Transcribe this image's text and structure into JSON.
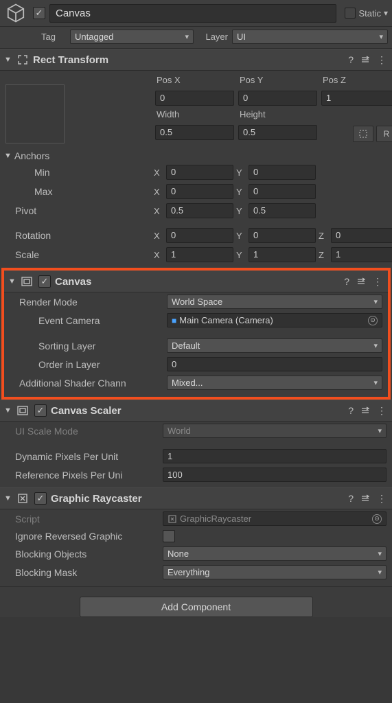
{
  "header": {
    "name": "Canvas",
    "enabled": true,
    "static_checked": false,
    "static_label": "Static",
    "tag_label": "Tag",
    "tag_value": "Untagged",
    "layer_label": "Layer",
    "layer_value": "UI"
  },
  "rect_transform": {
    "title": "Rect Transform",
    "pos_x_label": "Pos X",
    "pos_x": "0",
    "pos_y_label": "Pos Y",
    "pos_y": "0",
    "pos_z_label": "Pos Z",
    "pos_z": "1",
    "width_label": "Width",
    "width": "0.5",
    "height_label": "Height",
    "height": "0.5",
    "anchors_label": "Anchors",
    "min_label": "Min",
    "min_x": "0",
    "min_y": "0",
    "max_label": "Max",
    "max_x": "0",
    "max_y": "0",
    "pivot_label": "Pivot",
    "pivot_x": "0.5",
    "pivot_y": "0.5",
    "rotation_label": "Rotation",
    "rot_x": "0",
    "rot_y": "0",
    "rot_z": "0",
    "scale_label": "Scale",
    "scale_x": "1",
    "scale_y": "1",
    "scale_z": "1",
    "blueprint_btn": "⊡",
    "raw_btn": "R"
  },
  "canvas": {
    "title": "Canvas",
    "render_mode_label": "Render Mode",
    "render_mode": "World Space",
    "event_camera_label": "Event Camera",
    "event_camera": "Main Camera (Camera)",
    "sorting_layer_label": "Sorting Layer",
    "sorting_layer": "Default",
    "order_in_layer_label": "Order in Layer",
    "order_in_layer": "0",
    "add_shader_label": "Additional Shader Chann",
    "add_shader": "Mixed..."
  },
  "canvas_scaler": {
    "title": "Canvas Scaler",
    "ui_scale_mode_label": "UI Scale Mode",
    "ui_scale_mode": "World",
    "dyn_px_label": "Dynamic Pixels Per Unit",
    "dyn_px": "1",
    "ref_px_label": "Reference Pixels Per Uni",
    "ref_px": "100"
  },
  "graphic_raycaster": {
    "title": "Graphic Raycaster",
    "script_label": "Script",
    "script": "GraphicRaycaster",
    "ignore_reversed_label": "Ignore Reversed Graphic",
    "ignore_reversed": false,
    "blocking_objects_label": "Blocking Objects",
    "blocking_objects": "None",
    "blocking_mask_label": "Blocking Mask",
    "blocking_mask": "Everything"
  },
  "add_component_label": "Add Component",
  "axes": {
    "X": "X",
    "Y": "Y",
    "Z": "Z"
  }
}
